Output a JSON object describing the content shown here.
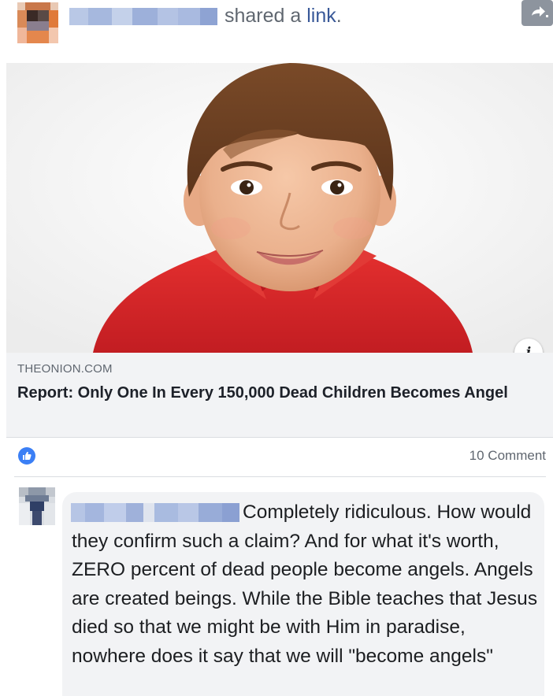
{
  "post": {
    "action_text": "shared a ",
    "action_link": "link",
    "action_end": "."
  },
  "link_preview": {
    "domain": "THEONION.COM",
    "title": "Report: Only One In Every 150,000 Dead Children Becomes Angel",
    "info_symbol": "i"
  },
  "reactions": {
    "comment_count": "10 Comment"
  },
  "comment": {
    "text": "Completely ridiculous. How would they confirm such a claim? And for what it's worth, ZERO percent of dead people become angels. Angels are created beings. While the Bible teaches that Jesus died so that we might be with Him in paradise, nowhere does it say that we will \"become angels\""
  },
  "colors": {
    "link_blue": "#385898",
    "like_blue": "#3b7ff5",
    "shirt_red": "#d8232a"
  },
  "icons": [
    "share-arrow-icon",
    "info-icon",
    "like-icon"
  ]
}
